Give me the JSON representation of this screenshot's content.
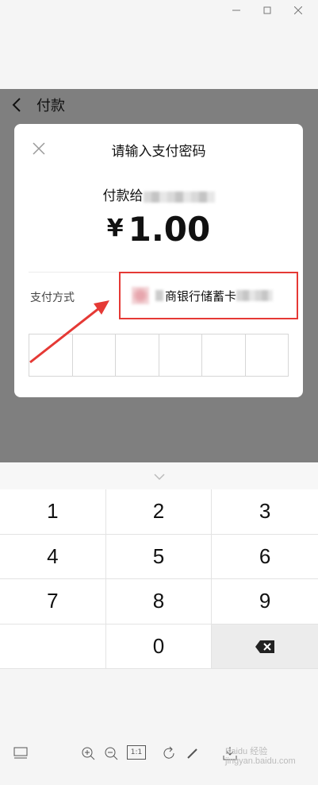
{
  "window": {
    "controls": [
      "minimize-icon",
      "maximize-icon",
      "close-icon"
    ]
  },
  "topbar": {
    "title": "付款"
  },
  "modal": {
    "title": "请输入支付密码",
    "payee_prefix": "付款给",
    "currency": "¥",
    "amount": "1.00",
    "pay_label": "支付方式",
    "pay_method": "商银行储蓄卡",
    "password_cells": 6
  },
  "keypad": {
    "keys": [
      "1",
      "2",
      "3",
      "4",
      "5",
      "6",
      "7",
      "8",
      "9",
      "",
      "0"
    ],
    "delete_icon": "backspace-icon"
  },
  "toolbar": {
    "icons": [
      "layout-icon",
      "zoom-in-icon",
      "zoom-out-icon",
      "actual-size-icon",
      "rotate-icon",
      "edit-icon",
      "download-icon"
    ],
    "actual_size_label": "1:1"
  },
  "watermark": {
    "brand": "Baidu 经验",
    "domain": "jingyan.baidu.com"
  },
  "colors": {
    "annotation": "#e53935",
    "overlay": "#7f7f7f"
  }
}
